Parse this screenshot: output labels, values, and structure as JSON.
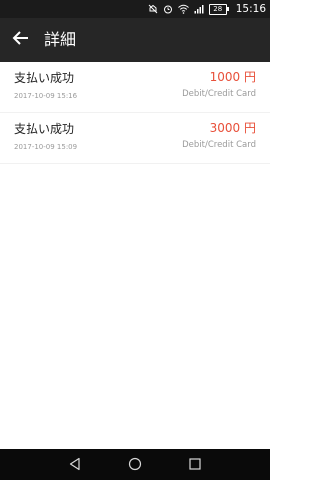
{
  "status_bar": {
    "battery_level": "28",
    "time": "15:16",
    "icons": [
      "mute-icon",
      "alarm-icon",
      "wifi-icon",
      "signal-icon",
      "battery-icon"
    ]
  },
  "toolbar": {
    "title": "詳細",
    "back_icon": "arrow-left-icon"
  },
  "transactions": [
    {
      "status": "支払い成功",
      "datetime": "2017-10-09 15:16",
      "amount": "1000 円",
      "method": "Debit/Credit Card"
    },
    {
      "status": "支払い成功",
      "datetime": "2017-10-09 15:09",
      "amount": "3000 円",
      "method": "Debit/Credit Card"
    }
  ],
  "nav_bar": {
    "icons": [
      "back-triangle-icon",
      "home-circle-icon",
      "recent-square-icon"
    ]
  },
  "colors": {
    "toolbar_bg": "#262626",
    "amount_red": "#e8503a",
    "secondary_text": "#9a9a9a"
  }
}
